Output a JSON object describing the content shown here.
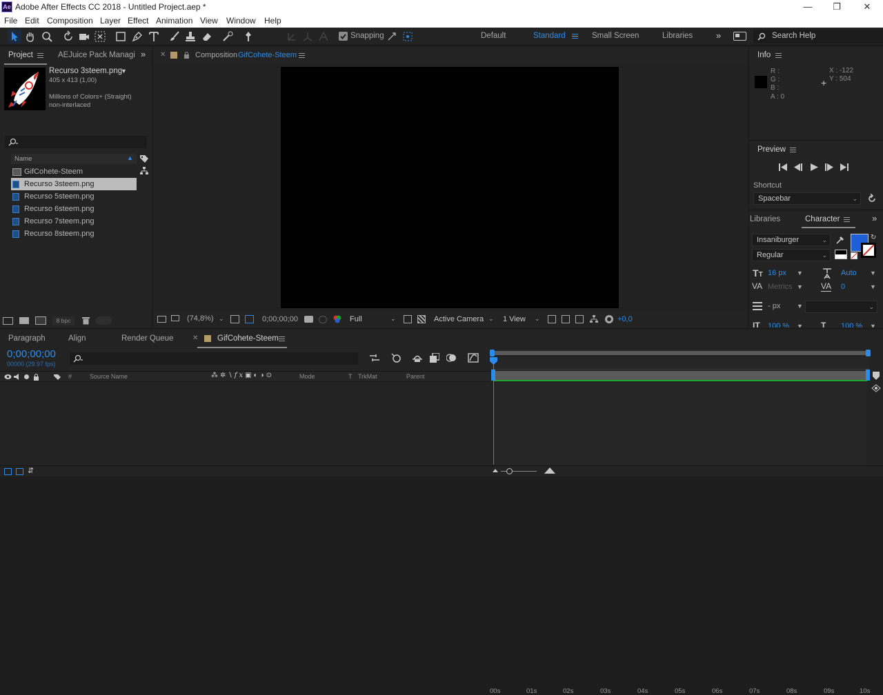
{
  "window": {
    "title": "Adobe After Effects CC 2018 - Untitled Project.aep *",
    "logo": "Ae"
  },
  "menu": [
    "File",
    "Edit",
    "Composition",
    "Layer",
    "Effect",
    "Animation",
    "View",
    "Window",
    "Help"
  ],
  "toolbar": {
    "snapping_label": "Snapping",
    "workspaces": [
      "Default",
      "Standard",
      "Small Screen",
      "Libraries"
    ],
    "active_workspace": "Standard",
    "search_placeholder": "Search Help"
  },
  "project_panel": {
    "tabs": [
      "Project",
      "AEJuice Pack Managi"
    ],
    "selected_item": {
      "name": "Recurso 3steem.png",
      "dimensions": "405 x 413 (1,00)",
      "color_info": "Millions of Colors+ (Straight)",
      "interlace": "non-interlaced"
    },
    "search_placeholder": "",
    "column_name": "Name",
    "items": [
      {
        "name": "GifCohete-Steem",
        "type": "composition"
      },
      {
        "name": "Recurso 3steem.png",
        "type": "image",
        "selected": true
      },
      {
        "name": "Recurso 5steem.png",
        "type": "image"
      },
      {
        "name": "Recurso 6steem.png",
        "type": "image"
      },
      {
        "name": "Recurso 7steem.png",
        "type": "image"
      },
      {
        "name": "Recurso 8steem.png",
        "type": "image"
      }
    ],
    "bpc": "8 bpc"
  },
  "composition_panel": {
    "tab_prefix": "Composition",
    "comp_name": "GifCohete-Steem",
    "zoom": "(74,8%)",
    "timecode": "0;00;00;00",
    "resolution": "Full",
    "camera": "Active Camera",
    "views": "1 View",
    "exposure": "+0,0"
  },
  "info_panel": {
    "title": "Info",
    "r_label": "R :",
    "g_label": "G :",
    "b_label": "B :",
    "a_label": "A : 0",
    "x_label": "X : -122",
    "y_label": "Y : 504"
  },
  "preview_panel": {
    "title": "Preview",
    "shortcut_label": "Shortcut",
    "shortcut_value": "Spacebar"
  },
  "character_panel": {
    "tabs": [
      "Libraries",
      "Character"
    ],
    "font_family": "Insaniburger",
    "font_style": "Regular",
    "font_size": "16 px",
    "leading": "Auto",
    "kerning": "Metrics",
    "tracking": "0",
    "stroke_width": "- px",
    "stroke_value": "",
    "fill_color": "#1f5fd6",
    "scale_v": "100 %",
    "scale_h": "100 %"
  },
  "bottom_tabs": [
    "Paragraph",
    "Align",
    "Render Queue"
  ],
  "timeline": {
    "tab_name": "GifCohete-Steem",
    "timecode": "0;00;00;00",
    "frame_info": "00000 (29.97 fps)",
    "columns": {
      "source_name": "Source Name",
      "mode": "Mode",
      "t": "T",
      "trkmat": "TrkMat",
      "parent": "Parent",
      "number": "#"
    },
    "ruler_ticks": [
      "00s",
      "01s",
      "02s",
      "03s",
      "04s",
      "05s",
      "06s",
      "07s",
      "08s",
      "09s",
      "10s"
    ]
  },
  "colors": {
    "accent": "#2d8ceb",
    "panel": "#232323",
    "background": "#1d1d1d",
    "work_area_green": "#22a828"
  }
}
